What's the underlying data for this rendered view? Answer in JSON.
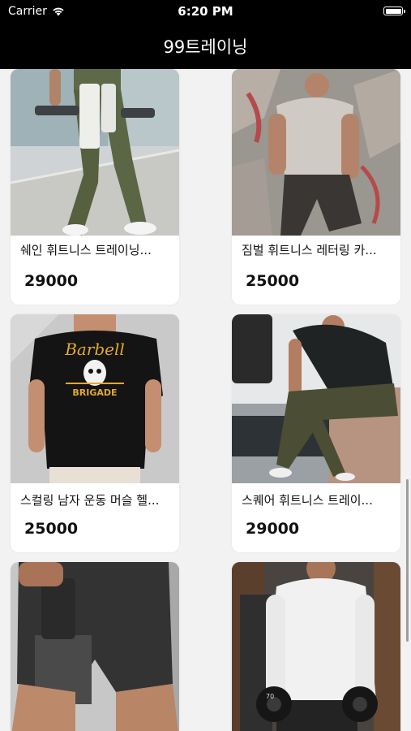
{
  "status_bar": {
    "carrier": "Carrier",
    "time": "6:20 PM"
  },
  "nav": {
    "title": "99트레이닝"
  },
  "products": [
    {
      "name": "쉐인 휘트니스 트레이닝...",
      "price": "29000"
    },
    {
      "name": "짐벌 휘트니스 레터링 카...",
      "price": "25000"
    },
    {
      "name": "스컬링 남자 운동 머슬 헬...",
      "price": "25000"
    },
    {
      "name": "스퀘어 휘트니스 트레이...",
      "price": "29000"
    },
    {
      "name": "",
      "price": ""
    },
    {
      "name": "",
      "price": ""
    }
  ],
  "images": {
    "tshirt_print_line1": "Barbell",
    "tshirt_print_line2": "BRIGADE",
    "dumbbell_label": "70"
  },
  "colors": {
    "nav_background": "#000000",
    "page_background": "#f2f2f2",
    "card_background": "#ffffff"
  }
}
